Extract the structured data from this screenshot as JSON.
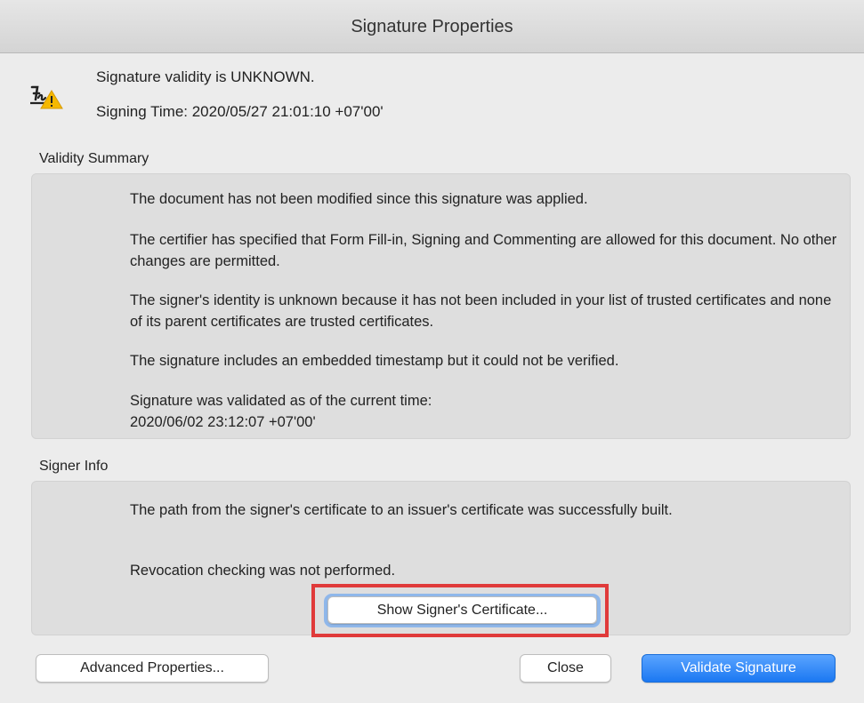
{
  "window": {
    "title": "Signature Properties"
  },
  "status": {
    "icon": "signature-warning-icon",
    "validity_text": "Signature validity is UNKNOWN.",
    "signing_time": "Signing Time:  2020/05/27 21:01:10 +07'00'"
  },
  "validity_summary": {
    "title": "Validity Summary",
    "messages": [
      "The document has not been modified since this signature was applied.",
      "The certifier has specified that Form Fill-in, Signing and Commenting are allowed for this document. No other changes are permitted.",
      "The signer's identity is unknown because it has not been included in your list of trusted certificates and none of its parent certificates are trusted certificates.",
      "The signature includes an embedded timestamp but it could not be verified.",
      "Signature was validated as of the current time:\n2020/06/02 23:12:07 +07'00'"
    ]
  },
  "signer_info": {
    "title": "Signer Info",
    "messages": [
      "The path from the signer's certificate to an issuer's certificate was successfully built.",
      "Revocation checking was not performed."
    ],
    "show_certificate_label": "Show Signer's Certificate..."
  },
  "footer": {
    "advanced_label": "Advanced Properties...",
    "close_label": "Close",
    "validate_label": "Validate Signature"
  },
  "colors": {
    "accent_blue": "#1b78f2",
    "warning_yellow": "#f5b800",
    "highlight_red": "#e03a3a"
  }
}
